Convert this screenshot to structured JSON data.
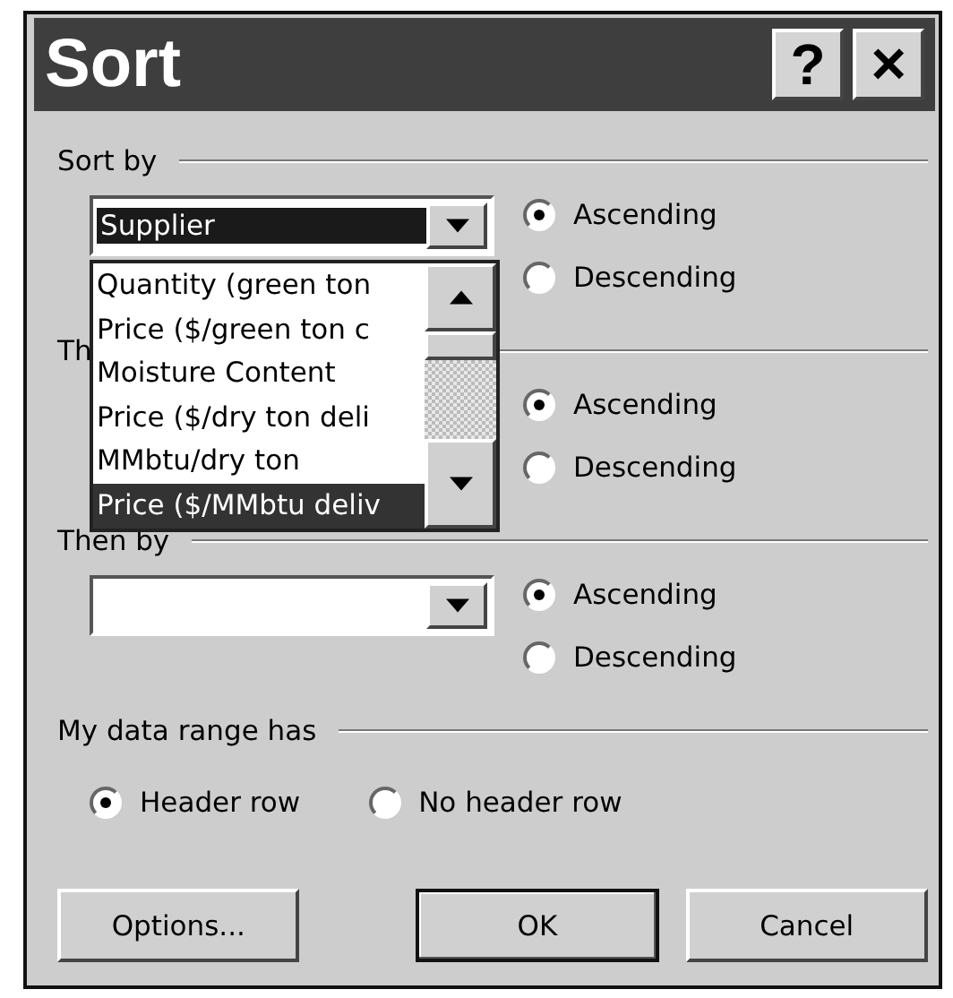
{
  "window": {
    "title": "Sort",
    "title_buttons": [
      {
        "kind": "help",
        "label": "?"
      },
      {
        "kind": "close",
        "label": "×"
      }
    ]
  },
  "sections": [
    {
      "label": "Sort by",
      "combo": {
        "value": "Supplier",
        "focused": true,
        "expanded": true,
        "list": [
          {
            "label": "Quantity (green ton",
            "selected": false
          },
          {
            "label": "Price ($/green ton c",
            "selected": false
          },
          {
            "label": "Moisture Content",
            "selected": false
          },
          {
            "label": "Price ($/dry ton deli",
            "selected": false
          },
          {
            "label": "MMbtu/dry ton",
            "selected": false
          },
          {
            "label": "Price ($/MMbtu deliv",
            "selected": true
          }
        ]
      },
      "order": [
        {
          "label": "Ascending",
          "selected": true
        },
        {
          "label": "Descending",
          "selected": false
        }
      ]
    },
    {
      "label": "Th",
      "order": [
        {
          "label": "Ascending",
          "selected": true
        },
        {
          "label": "Descending",
          "selected": false
        }
      ]
    },
    {
      "label": "Then by",
      "combo": {
        "focused": false,
        "expanded": false
      },
      "order": [
        {
          "label": "Ascending",
          "selected": true
        },
        {
          "label": "Descending",
          "selected": false
        }
      ]
    }
  ],
  "data_range": {
    "label": "My data range has",
    "options": [
      {
        "label": "Header row",
        "selected": true
      },
      {
        "label": "No header row",
        "selected": false
      }
    ]
  },
  "buttons": [
    {
      "label": "Options...",
      "default": false
    },
    {
      "label": "OK",
      "default": true
    },
    {
      "label": "Cancel",
      "default": false
    }
  ]
}
